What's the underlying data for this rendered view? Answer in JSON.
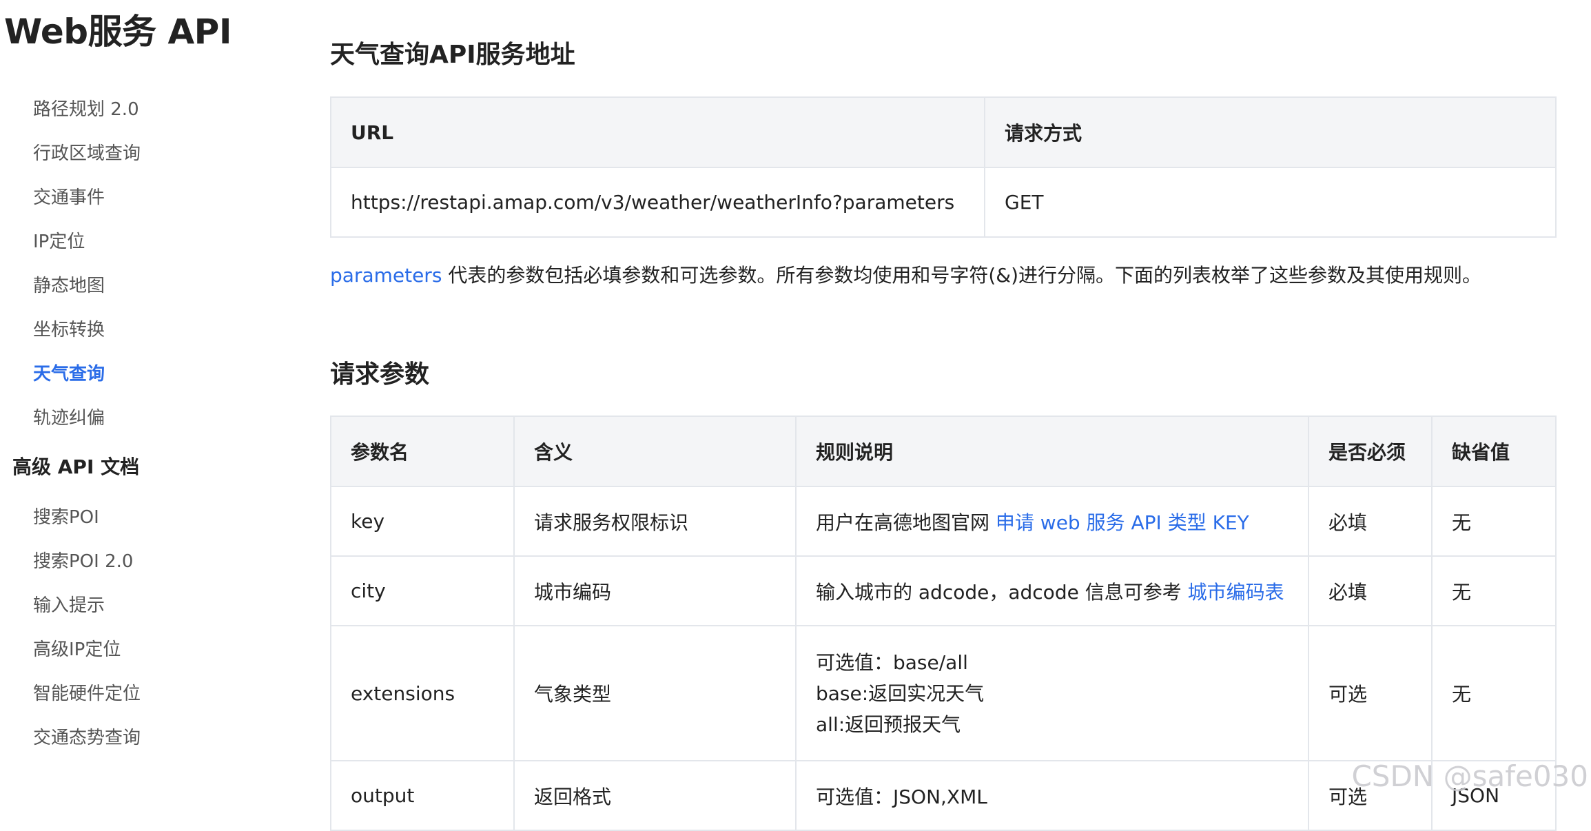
{
  "sidebar": {
    "title": "Web服务 API",
    "items": [
      {
        "label": "路径规划 2.0"
      },
      {
        "label": "行政区域查询"
      },
      {
        "label": "交通事件"
      },
      {
        "label": "IP定位"
      },
      {
        "label": "静态地图"
      },
      {
        "label": "坐标转换"
      },
      {
        "label": "天气查询",
        "active": true
      },
      {
        "label": "轨迹纠偏"
      }
    ],
    "section": "高级 API 文档",
    "section_items": [
      {
        "label": "搜索POI"
      },
      {
        "label": "搜索POI 2.0"
      },
      {
        "label": "输入提示"
      },
      {
        "label": "高级IP定位"
      },
      {
        "label": "智能硬件定位"
      },
      {
        "label": "交通态势查询"
      }
    ]
  },
  "service": {
    "heading": "天气查询API服务地址",
    "columns": [
      "URL",
      "请求方式"
    ],
    "row": [
      "https://restapi.amap.com/v3/weather/weatherInfo?parameters",
      "GET"
    ]
  },
  "paragraph": {
    "link": "parameters",
    "text": " 代表的参数包括必填参数和可选参数。所有参数均使用和号字符(&)进行分隔。下面的列表枚举了这些参数及其使用规则。"
  },
  "params": {
    "heading": "请求参数",
    "columns": [
      "参数名",
      "含义",
      "规则说明",
      "是否必须",
      "缺省值"
    ],
    "rows": [
      {
        "name": "key",
        "meaning": "请求服务权限标识",
        "rule_text": "用户在高德地图官网 ",
        "rule_link": "申请 web 服务 API 类型 KEY",
        "required": "必填",
        "default": "无"
      },
      {
        "name": "city",
        "meaning": "城市编码",
        "rule_text": "输入城市的 adcode，adcode 信息可参考 ",
        "rule_link": "城市编码表",
        "required": "必填",
        "default": "无"
      },
      {
        "name": "extensions",
        "meaning": "气象类型",
        "rule_lines": [
          "可选值：base/all",
          "base:返回实况天气",
          "all:返回预报天气"
        ],
        "required": "可选",
        "default": "无"
      },
      {
        "name": "output",
        "meaning": "返回格式",
        "rule_text": "可选值：JSON,XML",
        "required": "可选",
        "default": "JSON"
      }
    ]
  },
  "watermark": "CSDN @safe030"
}
